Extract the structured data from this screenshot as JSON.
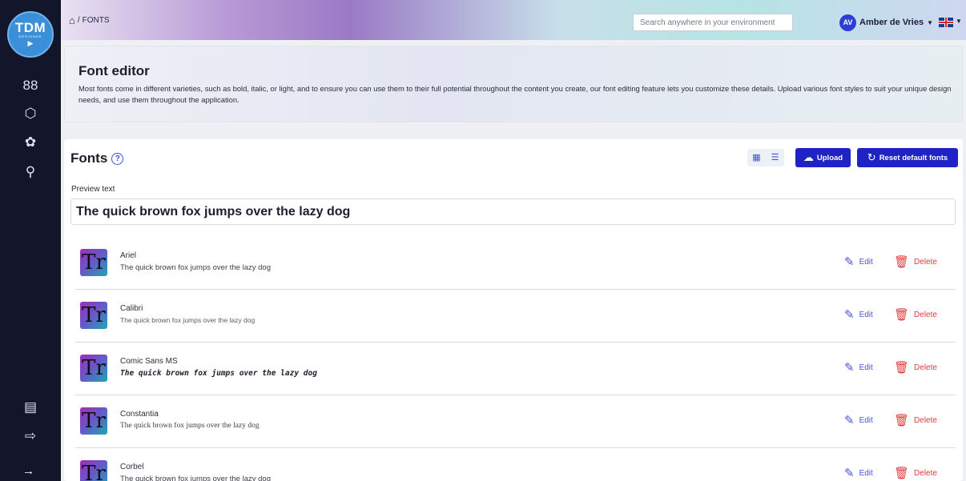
{
  "logo": {
    "line1": "TDM",
    "line2": "DESIGNER",
    "line3": "▶"
  },
  "sidebar": {
    "items": [
      {
        "icon": "grid-icon",
        "glyph": "88"
      },
      {
        "icon": "cube-icon",
        "glyph": "⬡"
      },
      {
        "icon": "palette-icon",
        "glyph": "✿"
      },
      {
        "icon": "route-icon",
        "glyph": "⚲"
      }
    ],
    "bottom": [
      {
        "icon": "notification-icon",
        "glyph": "▤"
      },
      {
        "icon": "logout-icon",
        "glyph": "⇨"
      }
    ],
    "expand_glyph": "→"
  },
  "header": {
    "breadcrumb_sep": "/",
    "breadcrumb": "FONTS",
    "search_placeholder": "Search anywhere in your environment",
    "user_initials": "AV",
    "user_name": "Amber de Vries"
  },
  "info": {
    "title": "Font editor",
    "description": "Most fonts come in different varieties, such as bold, italic, or light, and to ensure you can use them to their full potential throughout the content you create, our font editing feature lets you customize these details. Upload various font styles to suit your unique design needs, and use them throughout the application."
  },
  "fonts_panel": {
    "title": "Fonts",
    "help": "?",
    "upload_label": "Upload",
    "reset_label": "Reset default fonts",
    "preview_label": "Preview text",
    "preview_value": "The quick brown fox jumps over the lazy dog"
  },
  "actions": {
    "edit": "Edit",
    "delete": "Delete"
  },
  "fonts": [
    {
      "name": "Ariel",
      "sample": "The quick brown fox jumps over the lazy dog"
    },
    {
      "name": "Calibri",
      "sample": "The quick brown fox jumps over the lazy dog"
    },
    {
      "name": "Comic Sans MS",
      "sample": "The quick brown fox jumps over the lazy dog"
    },
    {
      "name": "Constantia",
      "sample": "The quick brown fox jumps over the lazy dog"
    },
    {
      "name": "Corbel",
      "sample": "The quick brown fox jumps over the lazy dog"
    }
  ],
  "colors": {
    "primary": "#1f22c4",
    "danger": "#e13a3a",
    "sidebar": "#13162a"
  }
}
